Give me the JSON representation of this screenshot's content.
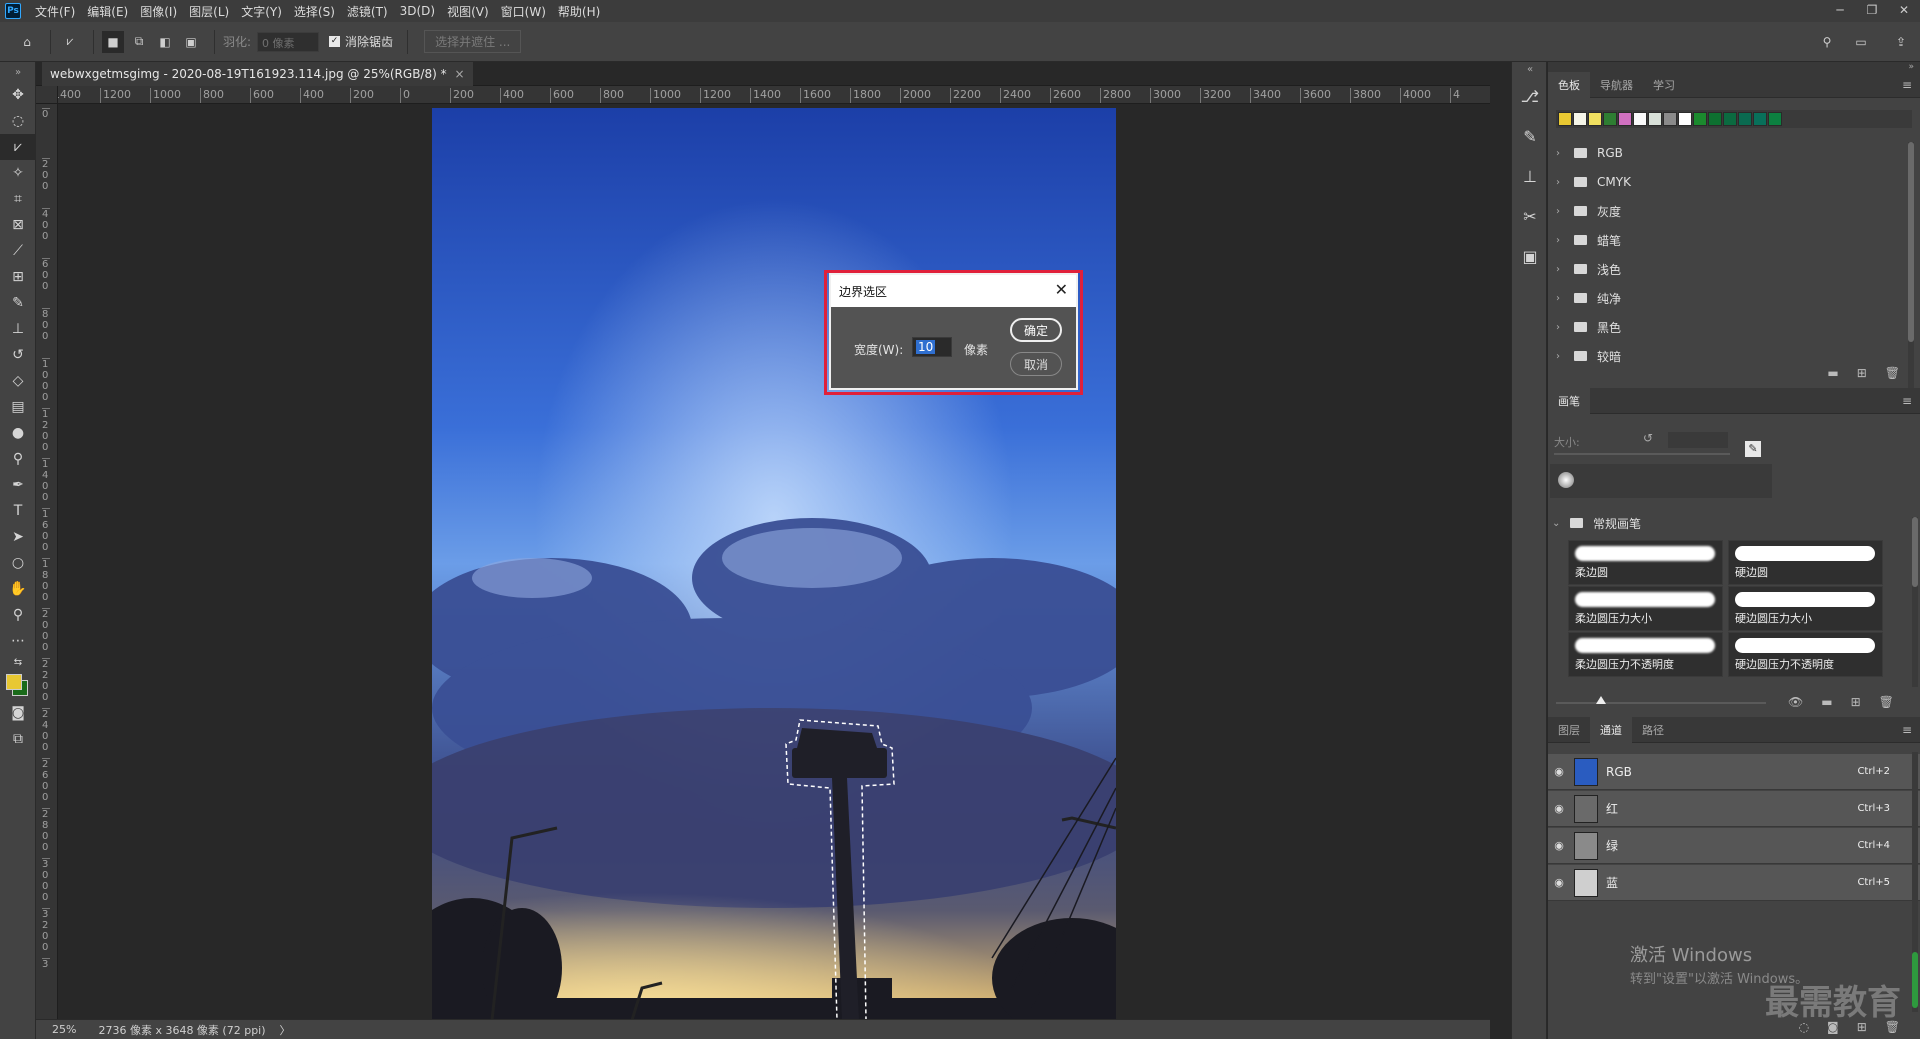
{
  "app": {
    "logo": "Ps",
    "menus": [
      "文件(F)",
      "编辑(E)",
      "图像(I)",
      "图层(L)",
      "文字(Y)",
      "选择(S)",
      "滤镜(T)",
      "3D(D)",
      "视图(V)",
      "窗口(W)",
      "帮助(H)"
    ],
    "win_controls": [
      "─",
      "❐",
      "✕"
    ]
  },
  "options": {
    "feather_label": "羽化:",
    "feather_value": "0 像素",
    "antialias_label": "消除锯齿",
    "select_mask": "选择并遮住 ..."
  },
  "document": {
    "tab_title": "webwxgetmsgimg - 2020-08-19T161923.114.jpg @ 25%(RGB/8) *",
    "close": "×"
  },
  "ruler": {
    "top": [
      "1400",
      "1200",
      "1000",
      "800",
      "600",
      "400",
      "200",
      "0",
      "200",
      "400",
      "600",
      "800",
      "1000",
      "1200",
      "1400",
      "1600",
      "1800",
      "2000",
      "2200",
      "2400",
      "2600",
      "2800",
      "3000",
      "3200",
      "3400",
      "3600",
      "3800",
      "4000",
      "4"
    ],
    "left": [
      "0",
      "200",
      "400",
      "600",
      "800",
      "1000",
      "1200",
      "1400",
      "1600",
      "1800",
      "2000",
      "2200",
      "2400",
      "2600",
      "2800",
      "3000",
      "3200",
      "3"
    ]
  },
  "status": {
    "zoom": "25%",
    "info": "2736 像素 x 3648 像素 (72 ppi)",
    "arrow": "〉"
  },
  "dialog": {
    "title": "边界选区",
    "width_label": "宽度(W):",
    "width_value": "10",
    "unit": "像素",
    "ok": "确定",
    "cancel": "取消",
    "close": "✕"
  },
  "swatches_panel": {
    "tabs": [
      "色板",
      "导航器",
      "学习"
    ],
    "colors": [
      "#e8c832",
      "#f5f5e8",
      "#f0e060",
      "#2e7d32",
      "#d070c0",
      "#fafafa",
      "#d8e0d8",
      "#8a8a8a",
      "#fefefe",
      "#1b8a2e",
      "#0d7030",
      "#0b6a40",
      "#0a6a50",
      "#08705a",
      "#0c8040"
    ],
    "folders": [
      "RGB",
      "CMYK",
      "灰度",
      "蜡笔",
      "浅色",
      "纯净",
      "黑色",
      "较暗"
    ]
  },
  "brush_panel": {
    "tab": "画笔",
    "size_label": "大小:",
    "group": "常规画笔",
    "brushes": [
      {
        "name": "柔边圆",
        "hard": false
      },
      {
        "name": "硬边圆",
        "hard": true
      },
      {
        "name": "柔边圆压力大小",
        "hard": false
      },
      {
        "name": "硬边圆压力大小",
        "hard": true
      },
      {
        "name": "柔边圆压力不透明度",
        "hard": false
      },
      {
        "name": "硬边圆压力不透明度",
        "hard": true
      }
    ]
  },
  "layers_panel": {
    "tabs": [
      "图层",
      "通道",
      "路径"
    ],
    "channels": [
      {
        "name": "RGB",
        "shortcut": "Ctrl+2",
        "thumb": "#2a5cc0"
      },
      {
        "name": "红",
        "shortcut": "Ctrl+3",
        "thumb": "#6a6a6a"
      },
      {
        "name": "绿",
        "shortcut": "Ctrl+4",
        "thumb": "#8a8a8a"
      },
      {
        "name": "蓝",
        "shortcut": "Ctrl+5",
        "thumb": "#cfcfcf"
      }
    ]
  },
  "watermark": {
    "line1": "激活 Windows",
    "line2": "转到\"设置\"以激活 Windows。",
    "logo": "最需教育"
  }
}
